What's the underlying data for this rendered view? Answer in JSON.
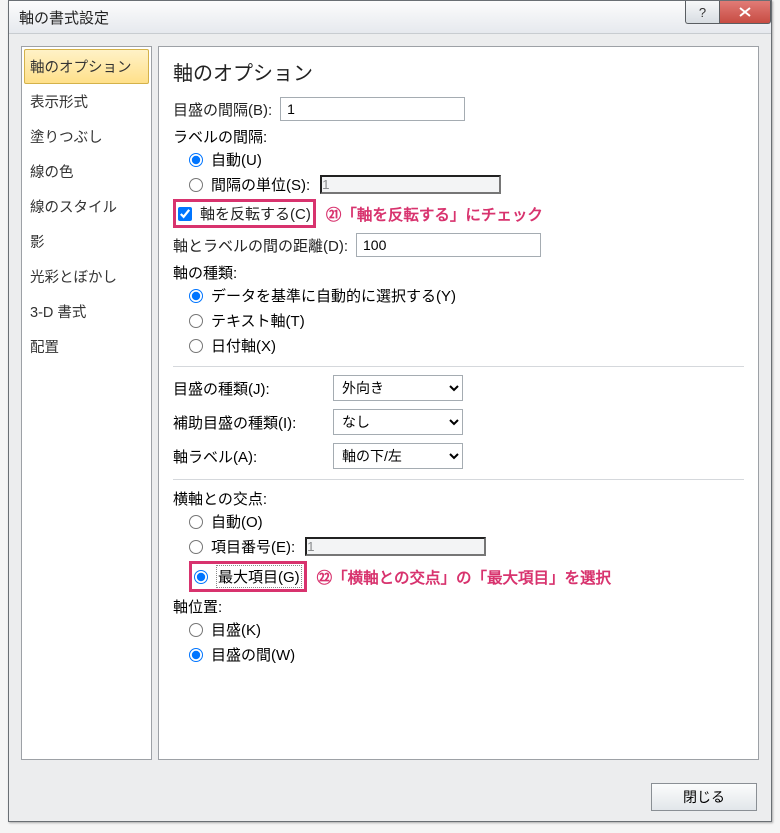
{
  "titlebar": {
    "title": "軸の書式設定",
    "help": "?",
    "close": "x"
  },
  "sidebar": {
    "items": [
      "軸のオプション",
      "表示形式",
      "塗りつぶし",
      "線の色",
      "線のスタイル",
      "影",
      "光彩とぼかし",
      "3-D 書式",
      "配置"
    ],
    "selected_index": 0
  },
  "main": {
    "heading": "軸のオプション",
    "major_unit": {
      "label": "目盛の間隔(B):",
      "value": "1"
    },
    "label_interval": {
      "label": "ラベルの間隔:",
      "auto": "自動(U)",
      "unit": "間隔の単位(S):",
      "unit_value": "1"
    },
    "reverse": {
      "label": "軸を反転する(C)",
      "checked": true
    },
    "axis_label_distance": {
      "label": "軸とラベルの間の距離(D):",
      "value": "100"
    },
    "axis_type": {
      "label": "軸の種類:",
      "auto": "データを基準に自動的に選択する(Y)",
      "text": "テキスト軸(T)",
      "date": "日付軸(X)"
    },
    "tick_major": {
      "label": "目盛の種類(J):",
      "value": "外向き"
    },
    "tick_minor": {
      "label": "補助目盛の種類(I):",
      "value": "なし"
    },
    "axis_labels": {
      "label": "軸ラベル(A):",
      "value": "軸の下/左"
    },
    "crosses": {
      "label": "横軸との交点:",
      "auto": "自動(O)",
      "category": "項目番号(E):",
      "category_value": "1",
      "max": "最大項目(G)"
    },
    "axis_position": {
      "label": "軸位置:",
      "on_tick": "目盛(K)",
      "between_tick": "目盛の間(W)"
    }
  },
  "annotations": {
    "a21": "㉑「軸を反転する」にチェック",
    "a22": "㉒「横軸との交点」の「最大項目」を選択"
  },
  "footer": {
    "close": "閉じる"
  }
}
